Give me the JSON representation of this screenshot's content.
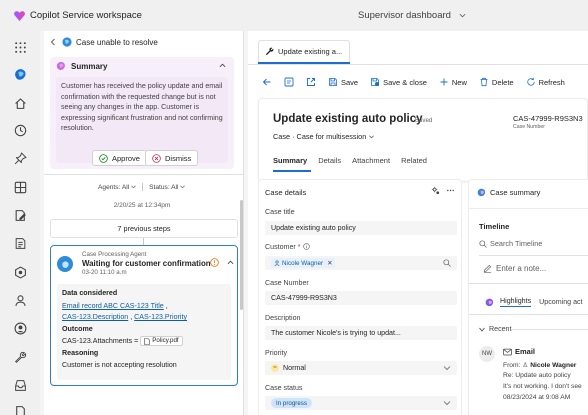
{
  "app": {
    "title": "Copilot Service workspace",
    "dashboard": "Supervisor dashboard",
    "brand_color": "#a855f7"
  },
  "rail": {
    "items": [
      {
        "icon": "apps-grid-icon"
      },
      {
        "icon": "copilot-icon"
      },
      {
        "icon": "home-icon"
      },
      {
        "icon": "recent-icon"
      },
      {
        "icon": "pin-icon"
      },
      {
        "icon": "layout-icon"
      },
      {
        "icon": "edit-document-icon"
      },
      {
        "icon": "list-document-icon"
      },
      {
        "icon": "routing-icon"
      },
      {
        "icon": "person-icon"
      },
      {
        "icon": "user-circle-icon"
      },
      {
        "icon": "wrench-icon"
      },
      {
        "icon": "inbox-icon"
      },
      {
        "icon": "document-icon"
      }
    ]
  },
  "left_panel": {
    "title": "Case unable to resolve",
    "summary": {
      "label": "Summary",
      "text": "Customer has received the policy update and email confirmation with the requested change but is not seeing any changes in the app. Customer is expressing significant frustration and not confirming resolution."
    },
    "approve_label": "Approve",
    "dismiss_label": "Dismiss",
    "filter_agents": "Agents: All",
    "filter_status": "Status: All",
    "timestamp": "2/20/25 at 12:34pm",
    "previous_steps": "7 previous steps",
    "agent": {
      "role": "Case Processing Agent",
      "title": "Waiting for customer confirmation",
      "date": "03-20 11:10 a.m",
      "data_considered_label": "Data considered",
      "link1": "Email record ABC CAS-123 Title",
      "link2": "CAS-123.Description",
      "link3": "CAS-123.Priority",
      "outcome_label": "Outcome",
      "outcome_text": "CAS-123.Attachments =",
      "attachment": "Policy.pdf",
      "reasoning_label": "Reasoning",
      "reasoning_text": "Customer is not accepting resolution"
    }
  },
  "main": {
    "tab_label": "Update existing a...",
    "commands": {
      "save": "Save",
      "save_close": "Save & close",
      "new": "New",
      "delete": "Delete",
      "refresh": "Refresh"
    },
    "record": {
      "title": "Update existing auto policy",
      "saved": "- Saved",
      "subtitle_entity": "Case",
      "subtitle_form": "Case for multisession",
      "case_number": "CAS-47999-R9S3N3",
      "case_number_label": "Case Number",
      "tabs": [
        "Summary",
        "Details",
        "Attachment",
        "Related"
      ]
    },
    "details": {
      "header": "Case details",
      "case_title_label": "Case title",
      "case_title": "Update existing auto policy",
      "customer_label": "Customer",
      "customer": "Nicole Wagner",
      "case_number_label": "Case Number",
      "case_number": "CAS-47999-R9S3N3",
      "description_label": "Description",
      "description": "The customer Nicole's is trying to updat...",
      "priority_label": "Priority",
      "priority": "Normal",
      "status_label": "Case status",
      "status": "In progress"
    },
    "copilot": {
      "header": "Case summary",
      "timeline_label": "Timeline",
      "search_placeholder": "Search Timeline",
      "note_placeholder": "Enter a note...",
      "tab_highlights": "Highlights",
      "tab_upcoming": "Upcoming act",
      "recent": "Recent",
      "avatar_initials": "NW",
      "email_label": "Email",
      "from_label": "From:",
      "from_name": "Nicole Wagner",
      "subject": "Re: Update auto policy",
      "preview": "It's not working. I don't see",
      "date": "08/23/2024 at 9:08 AM"
    }
  }
}
